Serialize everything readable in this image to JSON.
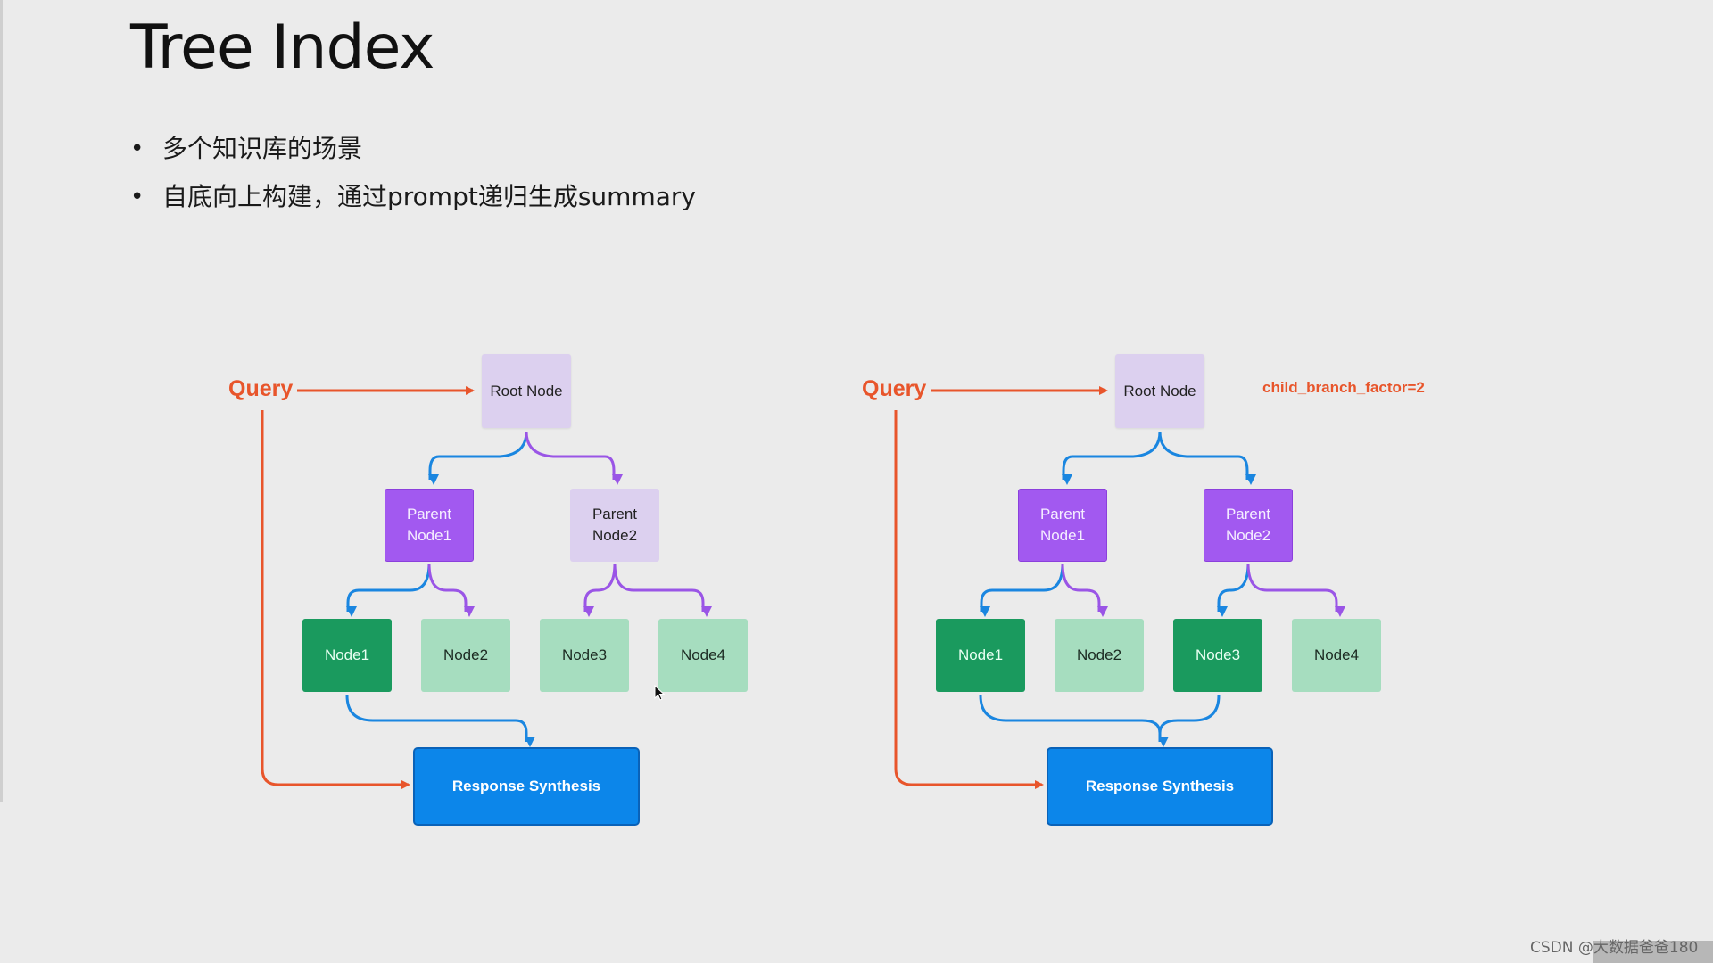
{
  "slide": {
    "title": "Tree Index",
    "bullets": [
      "多个知识库的场景",
      "自底向上构建，通过prompt递归生成summary"
    ]
  },
  "diagrams": [
    {
      "query": "Query",
      "root": "Root Node",
      "parent1": "Parent\nNode1",
      "parent2": "Parent\nNode2",
      "leaves": [
        "Node1",
        "Node2",
        "Node3",
        "Node4"
      ],
      "response": "Response Synthesis",
      "annotation": ""
    },
    {
      "query": "Query",
      "root": "Root Node",
      "parent1": "Parent\nNode1",
      "parent2": "Parent\nNode2",
      "leaves": [
        "Node1",
        "Node2",
        "Node3",
        "Node4"
      ],
      "response": "Response Synthesis",
      "annotation": "child_branch_factor=2"
    }
  ],
  "watermark": "CSDN @大数据爸爸180",
  "colors": {
    "query_orange": "#e8552b",
    "blue_arrow": "#1a86e0",
    "purple_arrow": "#9a55e6",
    "selected_parent": "#a259f0",
    "selected_leaf": "#1a9a5e",
    "response_blue": "#0c86ea"
  }
}
